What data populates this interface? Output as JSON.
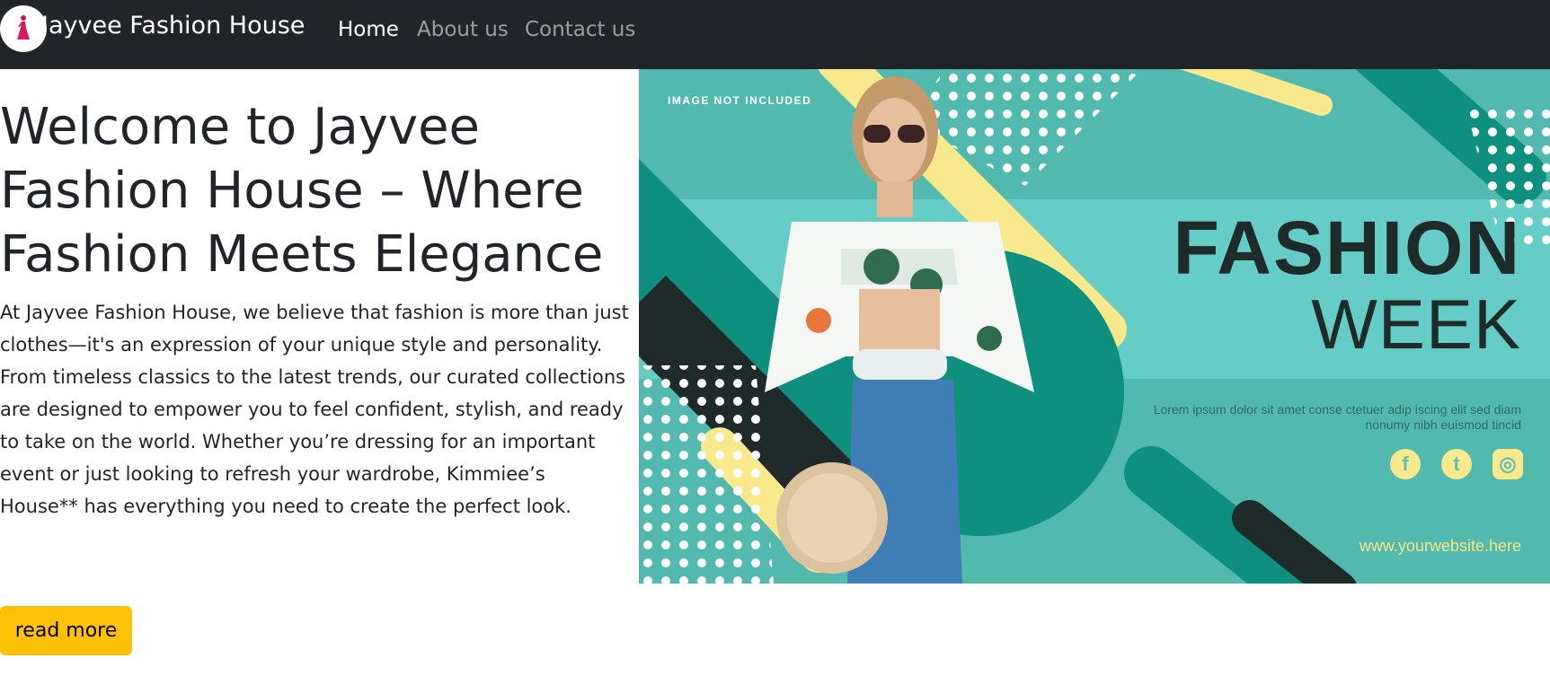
{
  "navbar": {
    "brand": "Jayvee Fashion House",
    "links": [
      {
        "label": "Home",
        "active": true
      },
      {
        "label": "About us",
        "active": false
      },
      {
        "label": "Contact us",
        "active": false
      }
    ]
  },
  "hero": {
    "title": "Welcome to Jayvee Fashion House – Where Fashion Meets Elegance",
    "body": "At Jayvee Fashion House, we believe that fashion is more than just clothes—it's an expression of your unique style and personality. From timeless classics to the latest trends, our curated collections are designed to empower you to feel confident, stylish, and ready to take on the world. Whether you’re dressing for an important event or just looking to refresh your wardrobe, Kimmiee’s House** has everything you need to create the perfect look.",
    "button_label": "read more"
  },
  "banner": {
    "watermark": "IMAGE NOT INCLUDED",
    "headline_1": "FASHION",
    "headline_2": "WEEK",
    "lorem": "Lorem ipsum dolor sit amet conse  ctetuer adip iscing elit sed diam nonumy nibh euismod tincid",
    "social": [
      {
        "icon": "facebook-icon",
        "glyph": "f"
      },
      {
        "icon": "twitter-icon",
        "glyph": "t"
      },
      {
        "icon": "instagram-icon",
        "glyph": "◎"
      }
    ],
    "website": "www.yourwebsite.here"
  },
  "colors": {
    "navbar_bg": "#212529",
    "button_bg": "#ffc107",
    "banner_teal": "#52b9ae",
    "banner_dark_teal": "#0f8f7e",
    "banner_yellow": "#f7e98c"
  }
}
